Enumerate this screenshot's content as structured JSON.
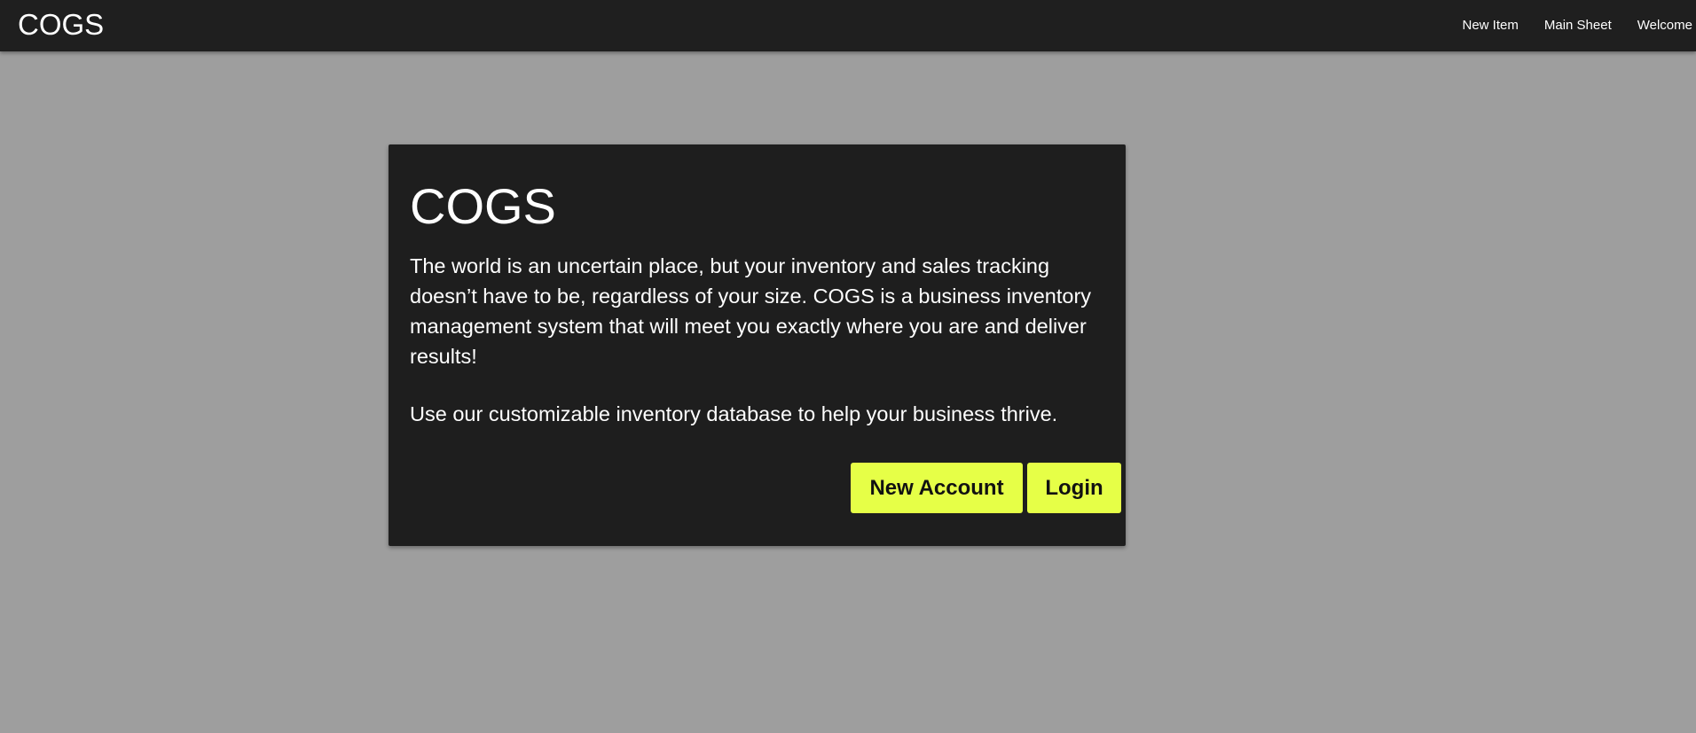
{
  "navbar": {
    "brand": "COGS",
    "links": [
      "New Item",
      "Main Sheet",
      "Welcome"
    ]
  },
  "card": {
    "title": "COGS",
    "paragraphs": [
      "The world is an uncertain place, but your inventory and sales tracking doesn’t have to be, regardless of your size. COGS is a business inventory management system that will meet you exactly where you are and deliver results!",
      "Use our customizable inventory database to help your business thrive."
    ],
    "buttons": {
      "new_account": "New Account",
      "login": "Login"
    }
  },
  "colors": {
    "page_background": "#9e9e9e",
    "navbar_background": "#1f1f1f",
    "card_background": "#1e1e1e",
    "button_accent": "#e6ff47"
  }
}
